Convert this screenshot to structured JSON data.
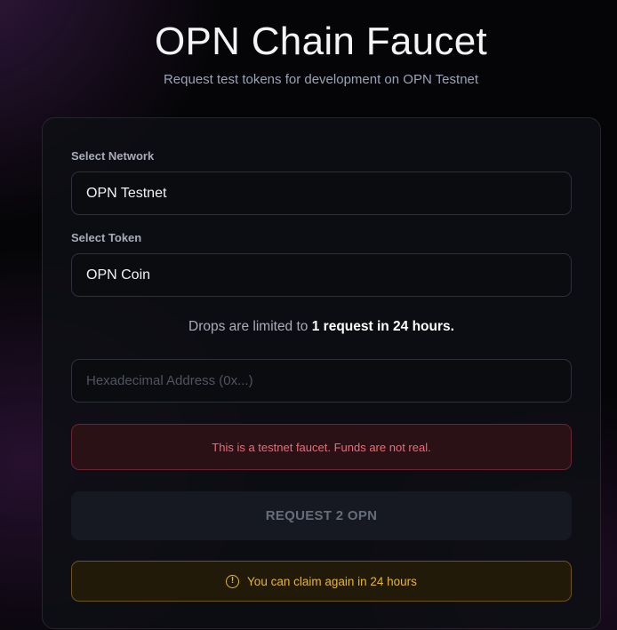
{
  "header": {
    "title": "OPN Chain Faucet",
    "subtitle": "Request test tokens for development on OPN Testnet"
  },
  "form": {
    "network_label": "Select Network",
    "network_value": "OPN Testnet",
    "token_label": "Select Token",
    "token_value": "OPN Coin",
    "limit_prefix": "Drops are limited to ",
    "limit_bold": "1 request in 24 hours.",
    "address_placeholder": "Hexadecimal Address (0x...)",
    "testnet_notice": "This is a testnet faucet. Funds are not real.",
    "request_button": "REQUEST 2 OPN",
    "claim_notice": "You can claim again in 24 hours",
    "claim_icon": "!"
  },
  "colors": {
    "error": "#f06a75",
    "warning": "#e7b62c",
    "background": "#050507"
  },
  "icons": {
    "claim_notice": "exclamation-circle-icon"
  }
}
